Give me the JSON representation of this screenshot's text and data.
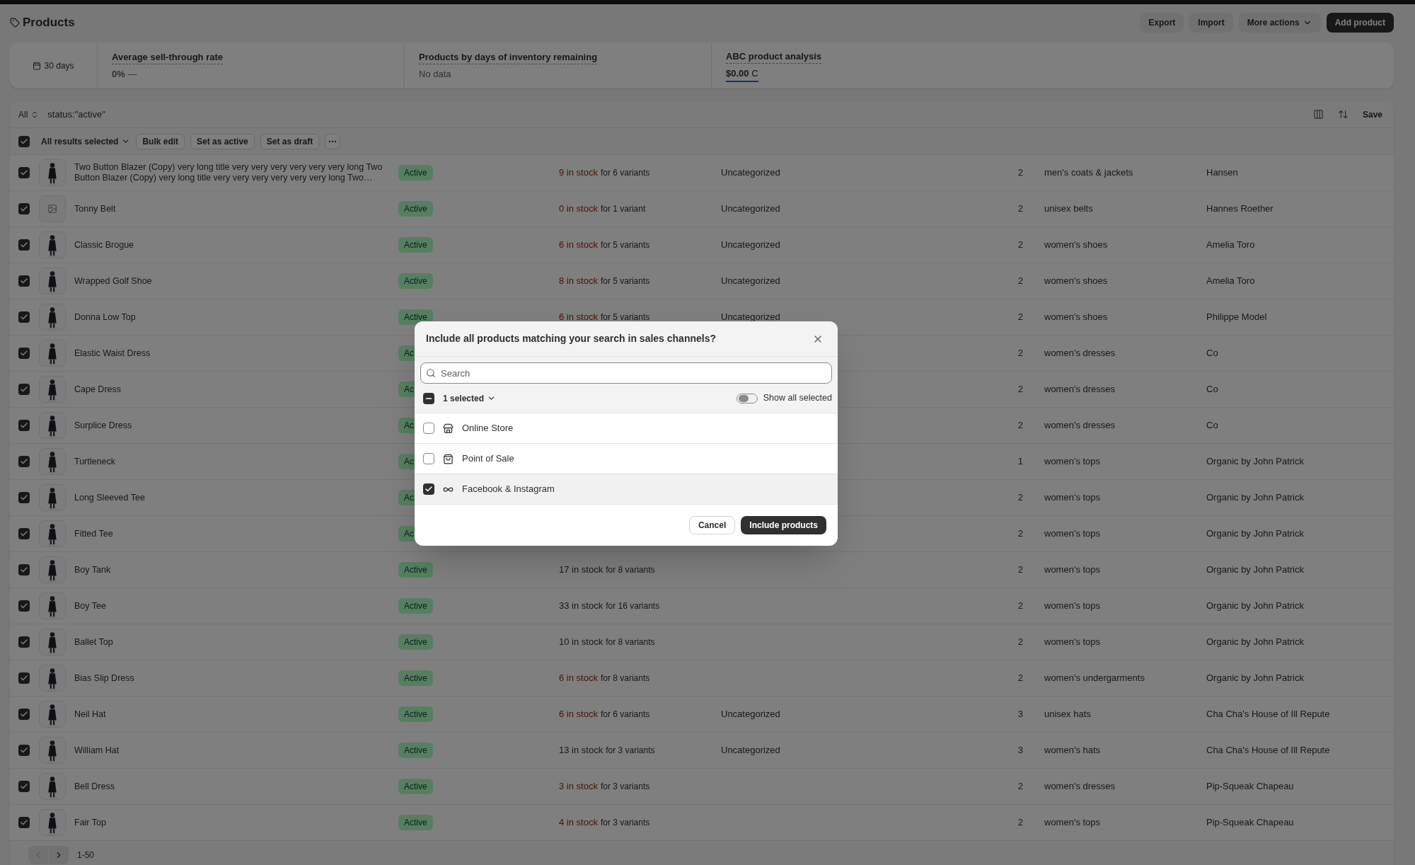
{
  "page": {
    "title": "Products"
  },
  "header_actions": [
    {
      "label": "Export",
      "kind": "default"
    },
    {
      "label": "Import",
      "kind": "default"
    },
    {
      "label": "More actions",
      "kind": "menu"
    },
    {
      "label": "Add product",
      "kind": "primary"
    }
  ],
  "analytics": {
    "date_range": "30 days",
    "metrics": [
      {
        "title": "Average sell-through rate",
        "value": "**0%** —",
        "highlighted": false
      },
      {
        "title": "Products by days of inventory remaining",
        "value": "No data",
        "highlighted": false
      },
      {
        "title": "ABC product analysis",
        "value": "**$0.00** C",
        "highlighted": true
      }
    ]
  },
  "filter": {
    "view": "All",
    "query": "status:\"active\"",
    "save": "Save"
  },
  "bulk_actions": {
    "all_selected": true,
    "selection": "All results selected",
    "buttons": [
      "Bulk edit",
      "Set as active",
      "Set as draft"
    ]
  },
  "rows": [
    {
      "selected": true,
      "name": "Two Button Blazer (Copy) very long title very very very very very very long Two Button Blazer (Copy) very long title very very very very very very long Two…",
      "status": "Active",
      "stock": "9 in stock",
      "variants": "for 6 variants",
      "low_stock": true,
      "category": "Uncategorized",
      "channels": "2",
      "type": "men's coats & jackets",
      "vendor": "Hansen"
    },
    {
      "selected": true,
      "thumbnail": {
        "kind": "placeholder"
      },
      "name": "Tonny Belt",
      "status": "Active",
      "stock": "0 in stock",
      "variants": "for 1 variant",
      "low_stock": true,
      "category": "Uncategorized",
      "channels": "2",
      "type": "unisex belts",
      "vendor": "Hannes Roether"
    },
    {
      "selected": true,
      "name": "Classic Brogue",
      "status": "Active",
      "stock": "6 in stock",
      "variants": "for 5 variants",
      "low_stock": true,
      "category": "Uncategorized",
      "channels": "2",
      "type": "women's shoes",
      "vendor": "Amelia Toro"
    },
    {
      "selected": true,
      "name": "Wrapped Golf Shoe",
      "status": "Active",
      "stock": "8 in stock",
      "variants": "for 5 variants",
      "low_stock": true,
      "category": "Uncategorized",
      "channels": "2",
      "type": "women's shoes",
      "vendor": "Amelia Toro"
    },
    {
      "selected": true,
      "name": "Donna Low Top",
      "status": "Active",
      "stock": "6 in stock",
      "variants": "for 5 variants",
      "low_stock": true,
      "category": "Uncategorized",
      "channels": "2",
      "type": "women's shoes",
      "vendor": "Philippe Model"
    },
    {
      "selected": true,
      "name": "Elastic Waist Dress",
      "status": "Ac",
      "channels": "2",
      "type": "women's dresses",
      "vendor": "Co"
    },
    {
      "selected": true,
      "name": "Cape Dress",
      "status": "Ac",
      "channels": "2",
      "type": "women's dresses",
      "vendor": "Co"
    },
    {
      "selected": true,
      "name": "Surplice Dress",
      "status": "Ac",
      "channels": "2",
      "type": "women's dresses",
      "vendor": "Co"
    },
    {
      "selected": true,
      "name": "Turtleneck",
      "status": "Ac",
      "channels": "1",
      "type": "women's tops",
      "vendor": "Organic by John Patrick"
    },
    {
      "selected": true,
      "name": "Long Sleeved Tee",
      "status": "Ac",
      "channels": "2",
      "type": "women's tops",
      "vendor": "Organic by John Patrick"
    },
    {
      "selected": true,
      "name": "Fitted Tee",
      "status": "Ac",
      "channels": "2",
      "type": "women's tops",
      "vendor": "Organic by John Patrick"
    },
    {
      "selected": true,
      "name": "Boy Tank",
      "status": "Active",
      "stock": "17 in stock",
      "variants": "for 8 variants",
      "low_stock": false,
      "channels": "2",
      "type": "women's tops",
      "vendor": "Organic by John Patrick"
    },
    {
      "selected": true,
      "name": "Boy Tee",
      "status": "Active",
      "stock": "33 in stock",
      "variants": "for 16 variants",
      "low_stock": false,
      "channels": "2",
      "type": "women's tops",
      "vendor": "Organic by John Patrick"
    },
    {
      "selected": true,
      "name": "Ballet Top",
      "status": "Active",
      "stock": "10 in stock",
      "variants": "for 8 variants",
      "low_stock": false,
      "channels": "2",
      "type": "women's tops",
      "vendor": "Organic by John Patrick"
    },
    {
      "selected": true,
      "name": "Bias Slip Dress",
      "status": "Active",
      "stock": "6 in stock",
      "variants": "for 8 variants",
      "low_stock": true,
      "channels": "2",
      "type": "women's undergarments",
      "vendor": "Organic by John Patrick"
    },
    {
      "selected": true,
      "name": "Neil Hat",
      "status": "Active",
      "stock": "6 in stock",
      "variants": "for 6 variants",
      "low_stock": true,
      "category": "Uncategorized",
      "channels": "3",
      "type": "unisex hats",
      "vendor": "Cha Cha's House of Ill Repute"
    },
    {
      "selected": true,
      "name": "William Hat",
      "status": "Active",
      "stock": "13 in stock",
      "variants": "for 3 variants",
      "low_stock": false,
      "category": "Uncategorized",
      "channels": "3",
      "type": "women's hats",
      "vendor": "Cha Cha's House of Ill Repute"
    },
    {
      "selected": true,
      "name": "Bell Dress",
      "status": "Active",
      "stock": "3 in stock",
      "variants": "for 3 variants",
      "low_stock": true,
      "channels": "2",
      "type": "women's dresses",
      "vendor": "Pip-Squeak Chapeau"
    },
    {
      "selected": true,
      "name": "Fair Top",
      "status": "Active",
      "stock": "4 in stock",
      "variants": "for 3 variants",
      "low_stock": true,
      "channels": "2",
      "type": "women's tops",
      "vendor": "Pip-Squeak Chapeau"
    }
  ],
  "pagination": {
    "range": "1-50",
    "previous_disabled": true
  },
  "dialog": {
    "title": "Include all products matching your search in sales channels?",
    "search": {
      "placeholder": "Search"
    },
    "selection": {
      "indeterminate": true,
      "label": "1 selected"
    },
    "show_all_selected": {
      "label": "Show all selected",
      "on": false
    },
    "channels": [
      {
        "name": "Online Store",
        "kind": "store",
        "checked": false
      },
      {
        "name": "Point of Sale",
        "kind": "pos",
        "checked": false
      },
      {
        "name": "Facebook & Instagram",
        "kind": "meta",
        "checked": true
      }
    ],
    "buttons": [
      {
        "label": "Cancel",
        "kind": "secondary"
      },
      {
        "label": "Include products",
        "kind": "primary"
      }
    ]
  }
}
